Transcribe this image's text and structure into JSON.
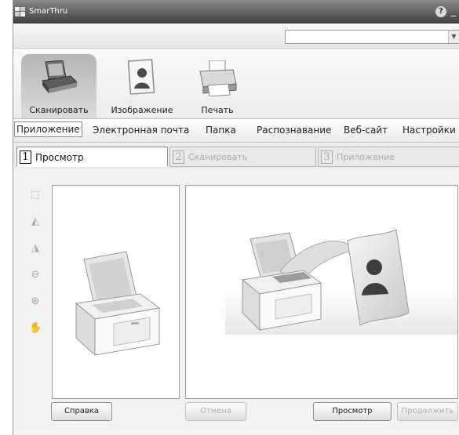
{
  "window": {
    "title": "SmarThru",
    "help_symbol": "?",
    "minimize_symbol": "_"
  },
  "toolbar": {
    "items": [
      {
        "label": "Сканировать",
        "icon": "scanner-icon",
        "active": true
      },
      {
        "label": "Изображение",
        "icon": "image-icon",
        "active": false
      },
      {
        "label": "Печать",
        "icon": "printer-icon",
        "active": false
      }
    ]
  },
  "destination_tabs": [
    {
      "label": "Приложение",
      "active": true
    },
    {
      "label": "Электронная почта",
      "active": false
    },
    {
      "label": "Папка",
      "active": false
    },
    {
      "label": "Распознавание",
      "active": false
    },
    {
      "label": "Веб-сайт",
      "active": false
    },
    {
      "label": "Настройки",
      "active": false
    }
  ],
  "steps": [
    {
      "num": "1",
      "label": "Просмотр",
      "active": true
    },
    {
      "num": "2",
      "label": "Сканировать",
      "active": false
    },
    {
      "num": "3",
      "label": "Приложение",
      "active": false
    }
  ],
  "side_tools": [
    "select-area-icon",
    "flip-horizontal-icon",
    "flip-vertical-icon",
    "zoom-out-icon",
    "zoom-in-icon",
    "hand-pan-icon"
  ],
  "buttons": {
    "help": "Справка",
    "cancel": "Отмена",
    "preview": "Просмотр",
    "continue": "Продолжить"
  },
  "colors": {
    "titlebar": "#3e3e3e",
    "accent_tab": "#b5b5b5"
  }
}
